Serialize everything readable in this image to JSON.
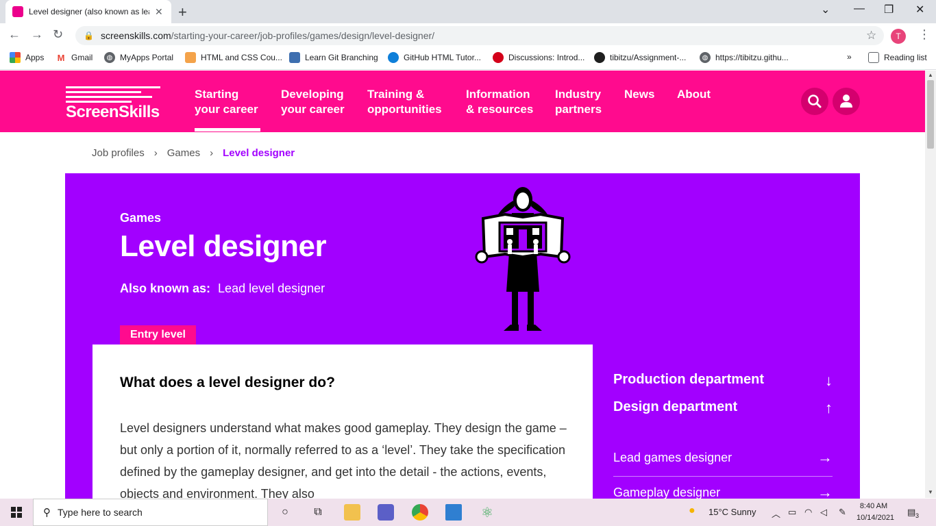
{
  "browser": {
    "tab_title": "Level designer (also known as lead level designer) - ScreenSkills",
    "url_host": "screenskills.com",
    "url_path": "/starting-your-career/job-profiles/games/design/level-designer/",
    "profile_initial": "T",
    "bookmarks": [
      {
        "label": "Apps"
      },
      {
        "label": "Gmail"
      },
      {
        "label": "MyApps Portal"
      },
      {
        "label": "HTML and CSS Cou..."
      },
      {
        "label": "Learn Git Branching"
      },
      {
        "label": "GitHub HTML Tutor..."
      },
      {
        "label": "Discussions: Introd..."
      },
      {
        "label": "tibitzu/Assignment-..."
      },
      {
        "label": "https://tibitzu.githu..."
      }
    ],
    "more_bookmarks": "»",
    "reading_list": "Reading list"
  },
  "site": {
    "logo_text": "ScreenSkills",
    "nav": [
      {
        "line1": "Starting",
        "line2": "your career"
      },
      {
        "line1": "Developing",
        "line2": "your career"
      },
      {
        "line1": "Training &",
        "line2": "opportunities"
      },
      {
        "line1": "Information",
        "line2": "& resources"
      },
      {
        "line1": "Industry",
        "line2": "partners"
      },
      {
        "line1": "News",
        "line2": ""
      },
      {
        "line1": "About",
        "line2": ""
      }
    ]
  },
  "breadcrumb": {
    "items": [
      "Job profiles",
      "Games",
      "Level designer"
    ],
    "separator": "›"
  },
  "hero": {
    "category": "Games",
    "title": "Level designer",
    "aka_label": "Also known as:",
    "aka_value": "Lead level designer",
    "badge": "Entry level"
  },
  "content": {
    "heading": "What does a level designer do?",
    "body": "Level designers understand what makes good gameplay. They design the game – but only a portion of it, normally referred to as a ‘level’.  They take the specification defined by the gameplay designer, and get into the detail - the actions, events, objects and environment. They also"
  },
  "sidebar": {
    "departments": [
      {
        "label": "Production department",
        "arrow": "↓"
      },
      {
        "label": "Design department",
        "arrow": "↑"
      }
    ],
    "links": [
      {
        "label": "Lead games designer",
        "arrow": "→"
      },
      {
        "label": "Gameplay designer",
        "arrow": "→"
      }
    ]
  },
  "taskbar": {
    "search_placeholder": "Type here to search",
    "weather": "15°C  Sunny",
    "time": "8:40 AM",
    "date": "10/14/2021",
    "notification_count": "3"
  },
  "colors": {
    "brand_pink": "#ff0b8e",
    "hero_purple": "#a200ff"
  }
}
